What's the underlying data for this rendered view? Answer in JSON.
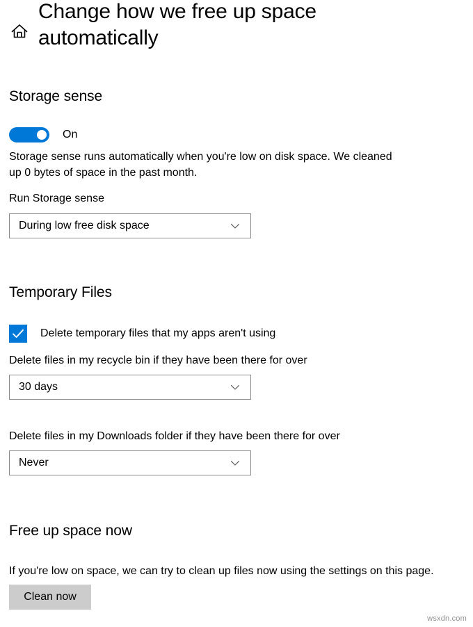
{
  "header": {
    "home_icon": "home-icon",
    "title": "Change how we free up space automatically"
  },
  "storage_sense": {
    "heading": "Storage sense",
    "toggle": {
      "state_label": "On",
      "checked": true,
      "accent_color": "#0078d7"
    },
    "description": "Storage sense runs automatically when you're low on disk space. We cleaned up 0 bytes of space in the past month.",
    "run_label": "Run Storage sense",
    "run_value": "During low free disk space",
    "chevron_icon": "chevron-down-icon"
  },
  "temporary_files": {
    "heading": "Temporary Files",
    "checkbox": {
      "label": "Delete temporary files that my apps aren't using",
      "checked": true,
      "accent_color": "#0078d7",
      "check_icon": "check-icon"
    },
    "recycle_bin_label": "Delete files in my recycle bin if they have been there for over",
    "recycle_bin_value": "30 days",
    "downloads_label": "Delete files in my Downloads folder if they have been there for over",
    "downloads_value": "Never"
  },
  "free_up_space": {
    "heading": "Free up space now",
    "description": "If you're low on space, we can try to clean up files now using the settings on this page.",
    "clean_button_label": "Clean now",
    "button_color": "#cccccc"
  },
  "watermark": {
    "text": "wsxdn.com"
  }
}
